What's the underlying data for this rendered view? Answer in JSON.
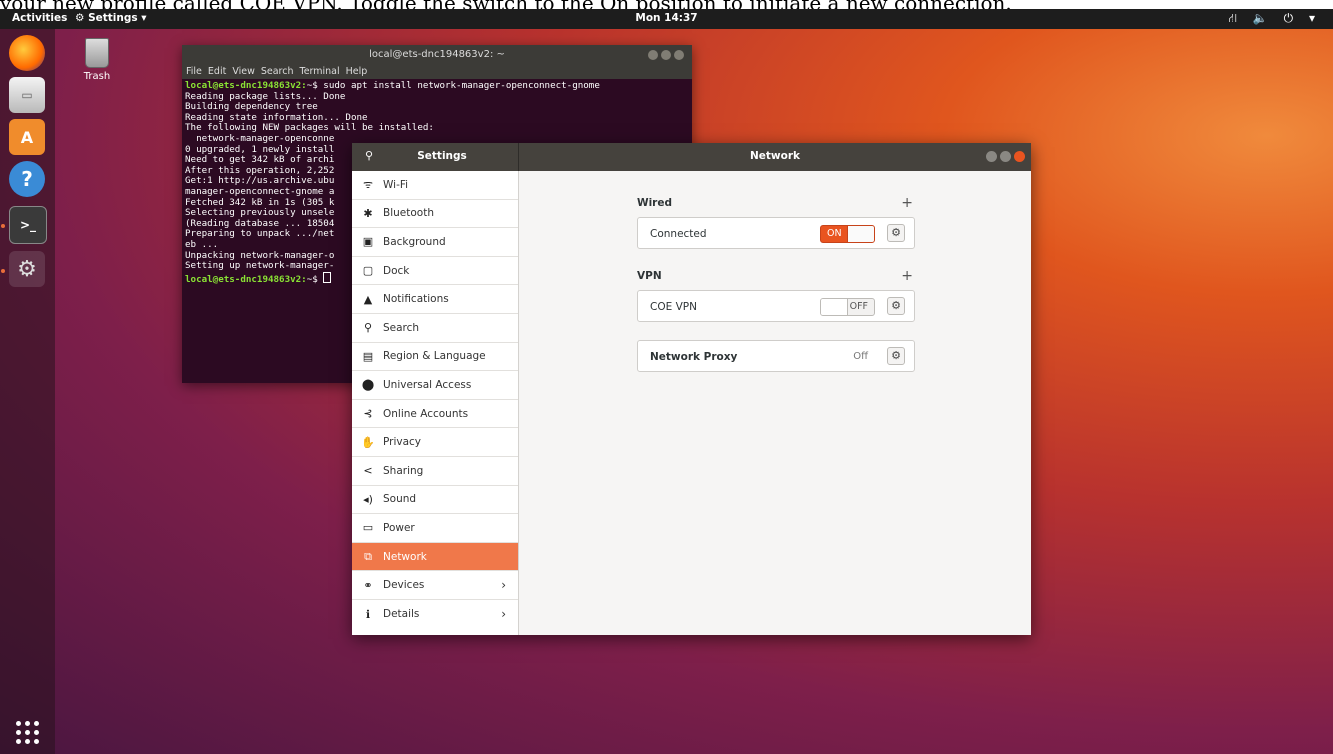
{
  "instruction": "your new profile called COE VPN. Toggle the switch to the On position to initiate a new connection.",
  "topbar": {
    "activities": "Activities",
    "app_menu": "⚙ Settings ▾",
    "clock": "Mon 14:37",
    "tray": "⛙ 🔈 ⏻ ▾"
  },
  "desktop": {
    "trash_label": "Trash"
  },
  "terminal": {
    "title": "local@ets-dnc194863v2: ~",
    "menu": [
      "File",
      "Edit",
      "View",
      "Search",
      "Terminal",
      "Help"
    ],
    "prompt1": "local@ets-dnc194863v2:",
    "command1": "~$ sudo apt install network-manager-openconnect-gnome",
    "lines": [
      "Reading package lists... Done",
      "Building dependency tree",
      "Reading state information... Done",
      "The following NEW packages will be installed:",
      "  network-manager-openconne",
      "0 upgraded, 1 newly install",
      "Need to get 342 kB of archi",
      "After this operation, 2,252",
      "Get:1 http://us.archive.ubu",
      "manager-openconnect-gnome a",
      "Fetched 342 kB in 1s (305 k",
      "Selecting previously unsele",
      "(Reading database ... 18504",
      "Preparing to unpack .../net",
      "eb ...",
      "Unpacking network-manager-o",
      "Setting up network-manager-"
    ],
    "prompt2": "local@ets-dnc194863v2:",
    "command2": "~$ "
  },
  "settings": {
    "left_title": "Settings",
    "right_title": "Network",
    "sidebar": [
      {
        "icon": "wifi-icon",
        "glyph": "ᯤ",
        "label": "Wi-Fi"
      },
      {
        "icon": "bluetooth-icon",
        "glyph": "✱",
        "label": "Bluetooth"
      },
      {
        "icon": "background-icon",
        "glyph": "▣",
        "label": "Background"
      },
      {
        "icon": "dock-icon",
        "glyph": "▢",
        "label": "Dock"
      },
      {
        "icon": "notifications-icon",
        "glyph": "▲",
        "label": "Notifications"
      },
      {
        "icon": "search-icon",
        "glyph": "⚲",
        "label": "Search"
      },
      {
        "icon": "region-language-icon",
        "glyph": "▤",
        "label": "Region & Language"
      },
      {
        "icon": "universal-access-icon",
        "glyph": "⬤",
        "label": "Universal Access"
      },
      {
        "icon": "online-accounts-icon",
        "glyph": "⊰",
        "label": "Online Accounts"
      },
      {
        "icon": "privacy-icon",
        "glyph": "✋",
        "label": "Privacy"
      },
      {
        "icon": "sharing-icon",
        "glyph": "<",
        "label": "Sharing"
      },
      {
        "icon": "sound-icon",
        "glyph": "◂)",
        "label": "Sound"
      },
      {
        "icon": "power-icon",
        "glyph": "▭",
        "label": "Power"
      },
      {
        "icon": "network-icon",
        "glyph": "⧉",
        "label": "Network"
      },
      {
        "icon": "devices-icon",
        "glyph": "⚭",
        "label": "Devices"
      },
      {
        "icon": "details-icon",
        "glyph": "ℹ",
        "label": "Details"
      }
    ],
    "chevron": "›",
    "wired": {
      "heading": "Wired",
      "add": "+",
      "row_label": "Connected",
      "switch_text": "ON"
    },
    "vpn": {
      "heading": "VPN",
      "add": "+",
      "row_label": "COE VPN",
      "switch_text": "OFF"
    },
    "proxy": {
      "row_label": "Network Proxy",
      "state": "Off"
    },
    "gear_glyph": "⚙"
  },
  "colors": {
    "accent": "#e95420",
    "sidebar_active": "#f0784a",
    "terminal_bg": "#2c0a22",
    "prompt": "#8ae234"
  }
}
